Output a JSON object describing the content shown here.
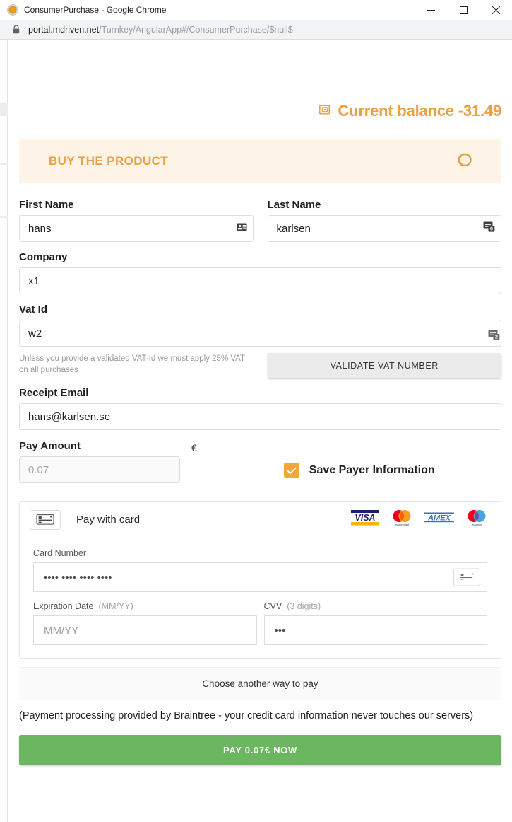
{
  "window": {
    "title": "ConsumerPurchase - Google Chrome",
    "icon": "chrome-app-icon",
    "minimize_label": "Minimize",
    "maximize_label": "Maximize",
    "close_label": "Close"
  },
  "omnibar": {
    "lock_icon": "lock-icon",
    "url_host": "portal.mdriven.net",
    "url_path": "/Turnkey/AngularApp#/ConsumerPurchase/$null$"
  },
  "balance": {
    "icon": "wallet-icon",
    "text": "Current balance -31.49"
  },
  "product_bar": {
    "title": "BUY THE PRODUCT",
    "icon": "eclipse-circles-icon"
  },
  "form": {
    "first_name": {
      "label": "First Name",
      "value": "hans",
      "placeholder": "",
      "icon": "contact-card-icon"
    },
    "last_name": {
      "label": "Last Name",
      "value": "karlsen",
      "placeholder": "",
      "icon": "autofill-badge-icon",
      "badge": "6"
    },
    "company": {
      "label": "Company",
      "value": "x1",
      "placeholder": ""
    },
    "vat_id": {
      "label": "Vat Id",
      "value": "w2",
      "placeholder": "",
      "icon": "autofill-badge-icon",
      "badge": "2"
    },
    "vat_note": "Unless you provide a validated VAT-Id we must apply 25% VAT on all purchases",
    "validate_vat_button": "VALIDATE VAT NUMBER",
    "receipt_email": {
      "label": "Receipt Email",
      "value": "hans@karlsen.se",
      "placeholder": ""
    },
    "pay_amount": {
      "label": "Pay Amount",
      "value": "",
      "placeholder": "0.07",
      "currency": "€"
    },
    "save_payer": {
      "label": "Save Payer Information",
      "checked": true,
      "check_icon": "checkmark-icon"
    }
  },
  "card": {
    "header_label": "Pay with card",
    "header_icon": "credit-card-icon",
    "brands": [
      "VISA",
      "mastercard",
      "AMEX",
      "maestro"
    ],
    "card_number": {
      "label": "Card Number",
      "value": "•••• •••• •••• ••••",
      "placeholder": "",
      "icon": "credit-card-icon"
    },
    "expiration": {
      "label": "Expiration Date",
      "hint": "(MM/YY)",
      "value": "",
      "placeholder": "MM/YY"
    },
    "cvv": {
      "label": "CVV",
      "hint": "(3 digits)",
      "value": "•••",
      "placeholder": ""
    },
    "another_way_link": "Choose another way to pay"
  },
  "footer": {
    "braintree_note": "(Payment processing provided by Braintree - your credit card information never touches our servers)",
    "pay_button": "PAY 0.07€ NOW"
  },
  "colors": {
    "accent_orange": "#eda040",
    "product_bar_bg": "#fdf3e6",
    "pay_green": "#6cb661",
    "checkbox_orange": "#f0a73c"
  }
}
